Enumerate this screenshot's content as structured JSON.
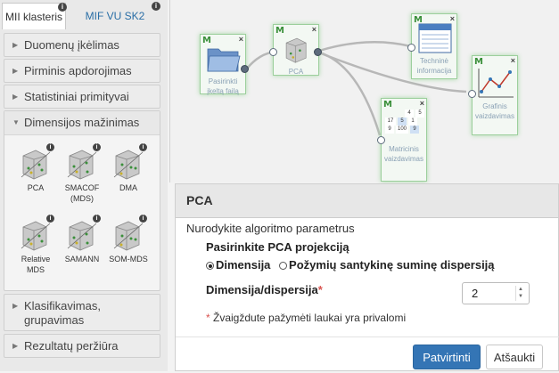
{
  "sidebar": {
    "tabs": [
      {
        "label": "MII klasteris",
        "badge": "i"
      },
      {
        "label": "MIF VU SK2",
        "badge": "i"
      }
    ],
    "sections": [
      {
        "label": "Duomenų įkėlimas"
      },
      {
        "label": "Pirminis apdorojimas"
      },
      {
        "label": "Statistiniai primityvai"
      },
      {
        "label": "Dimensijos mažinimas"
      },
      {
        "label": "Klasifikavimas, grupavimas"
      },
      {
        "label": "Rezultatų peržiūra"
      }
    ],
    "tools": [
      {
        "label": "PCA",
        "badge": "i"
      },
      {
        "label": "SMACOF (MDS)",
        "badge": "i"
      },
      {
        "label": "DMA",
        "badge": "i"
      },
      {
        "label": "Relative MDS",
        "badge": "i"
      },
      {
        "label": "SAMANN",
        "badge": "i"
      },
      {
        "label": "SOM-MDS",
        "badge": "i"
      }
    ]
  },
  "canvas": {
    "nodes": [
      {
        "label": "Pasirinkti įkeltą failą",
        "logo": "M",
        "close": "×"
      },
      {
        "label": "PCA",
        "logo": "M",
        "close": "×"
      },
      {
        "label": "Techninė informacija",
        "logo": "M",
        "close": "×"
      },
      {
        "label": "Matricinis vaizdavimas",
        "logo": "M",
        "close": "×"
      },
      {
        "label": "Grafinis vaizdavimas",
        "logo": "M",
        "close": "×"
      }
    ],
    "matrix_values": [
      "4",
      "5",
      "17",
      "5",
      "1",
      "9",
      "100",
      "9"
    ]
  },
  "dialog": {
    "title": "PCA",
    "instruction": "Nurodykite algoritmo parametrus",
    "projection_label": "Pasirinkite PCA projekciją",
    "options": [
      {
        "label": "Dimensija",
        "selected": true
      },
      {
        "label": "Požymių santykinę suminę dispersiją",
        "selected": false
      }
    ],
    "dimension_label": "Dimensija/dispersija",
    "required_mark": "*",
    "dimension_value": "2",
    "required_note_mark": "*",
    "required_note": "Žvaigždute pažymėti laukai yra privalomi",
    "confirm_label": "Patvirtinti",
    "cancel_label": "Atšaukti"
  },
  "colors": {
    "primary_button": "#3475b5",
    "required": "#d9534f",
    "node_glow": "#a9d9a9"
  }
}
